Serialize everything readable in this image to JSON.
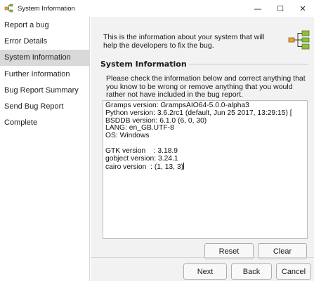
{
  "window": {
    "title": "System Information",
    "minimize": "—",
    "maximize": "☐",
    "close": "✕"
  },
  "sidebar": {
    "items": [
      {
        "label": "Report a bug"
      },
      {
        "label": "Error Details"
      },
      {
        "label": "System Information",
        "active": true
      },
      {
        "label": "Further Information"
      },
      {
        "label": "Bug Report Summary"
      },
      {
        "label": "Send Bug Report"
      },
      {
        "label": "Complete"
      }
    ]
  },
  "main": {
    "intro": "This is the information about your system that will help the developers to fix the bug.",
    "section_title": "System Information",
    "instructions": "Please check the information below and correct anything that you know to be wrong or remove anything that you would rather not have included in the bug report.",
    "sysinfo_lines": [
      "Gramps version: GrampsAIO64-5.0.0-alpha3",
      "Python version: 3.6.2rc1 (default, Jun 25 2017, 13:29:15) [",
      "BSDDB version: 6.1.0 (6, 0, 30)",
      "LANG: en_GB.UTF-8",
      "OS: Windows",
      "",
      "GTK version    : 3.18.9",
      "gobject version: 3.24.1",
      "cairo version  : (1, 13, 3)"
    ],
    "reset_label": "Reset",
    "clear_label": "Clear"
  },
  "footer": {
    "next_label": "Next",
    "back_label": "Back",
    "cancel_label": "Cancel"
  },
  "colors": {
    "sidebar_active": "#d9d9d9",
    "main_bg": "#f2f2f2",
    "icon_green": "#8fbf3f",
    "icon_orange": "#e8a33a"
  }
}
